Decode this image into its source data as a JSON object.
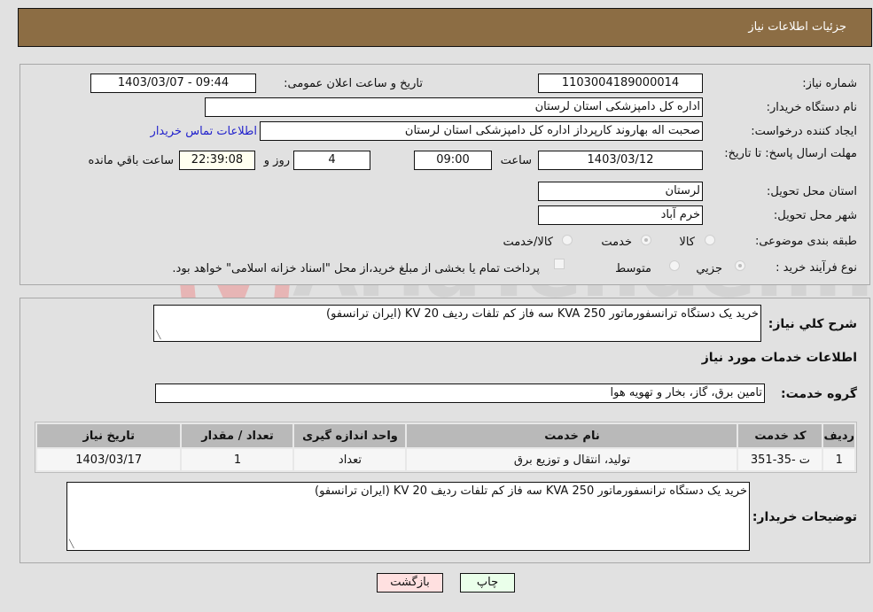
{
  "header": {
    "title": "جزئیات اطلاعات نیاز"
  },
  "details": {
    "need_number": {
      "label": "شماره نیاز:",
      "value": "1103004189000014"
    },
    "announce_datetime": {
      "label": "تاریخ و ساعت اعلان عمومی:",
      "value": "1403/03/07 - 09:44"
    },
    "buyer_org": {
      "label": "نام دستگاه خریدار:",
      "value": "اداره کل دامپزشکی استان لرستان"
    },
    "requester": {
      "label": "ایجاد کننده درخواست:",
      "value": "صحبت اله بهاروند کارپرداز اداره کل دامپزشکی استان لرستان"
    },
    "buyer_contact_link": "اطلاعات تماس خریدار",
    "deadline": {
      "label": "مهلت ارسال پاسخ: تا تاریخ:",
      "date": "1403/03/12",
      "time_label": "ساعت",
      "time": "09:00",
      "days": "4",
      "days_label": "روز و",
      "remaining": "22:39:08",
      "remaining_label": "ساعت باقي مانده"
    },
    "province": {
      "label": "استان محل تحویل:",
      "value": "لرستان"
    },
    "city": {
      "label": "شهر محل تحویل:",
      "value": "خرم آباد"
    },
    "category": {
      "label": "طبقه بندی موضوعی:",
      "options": [
        {
          "label": "کالا",
          "selected": false
        },
        {
          "label": "خدمت",
          "selected": true
        },
        {
          "label": "کالا/خدمت",
          "selected": false
        }
      ]
    },
    "purchase_process": {
      "label": "نوع فرآیند خرید :",
      "options": [
        {
          "label": "جزيي",
          "selected": true
        },
        {
          "label": "متوسط",
          "selected": false
        }
      ],
      "treasury_note": "پرداخت تمام یا بخشی از مبلغ خرید،از محل \"اسناد خزانه اسلامی\" خواهد بود.",
      "treasury_checked": false
    }
  },
  "summary": {
    "label": "شرح کلي نیاز:",
    "value": "خرید یک دستگاه ترانسفورماتور 250 KVA سه فاز کم تلفات ردیف 20 KV (ایران ترانسفو)"
  },
  "services": {
    "section_title": "اطلاعات خدمات مورد نیاز",
    "group_label": "گروه خدمت:",
    "group_value": "تامین برق، گاز، بخار و تهویه هوا",
    "table": {
      "headers": [
        "ردیف",
        "کد خدمت",
        "نام خدمت",
        "واحد اندازه گیری",
        "تعداد / مقدار",
        "تاریخ نیاز"
      ],
      "rows": [
        [
          "1",
          "ت -35-351",
          "تولید، انتقال و توزیع برق",
          "تعداد",
          "1",
          "1403/03/17"
        ]
      ]
    }
  },
  "buyer_notes": {
    "label": "توضیحات خریدار:",
    "value": "خرید یک دستگاه ترانسفورماتور 250 KVA سه فاز کم تلفات ردیف 20 KV (ایران ترانسفو)"
  },
  "buttons": {
    "print": "چاپ",
    "back": "بازگشت"
  },
  "colors": {
    "header_bg": "#8c6d44",
    "print_bg": "#eaffea",
    "back_bg": "#ffe0e0",
    "link": "#2222cc"
  },
  "watermark": "AriaTender.neT"
}
